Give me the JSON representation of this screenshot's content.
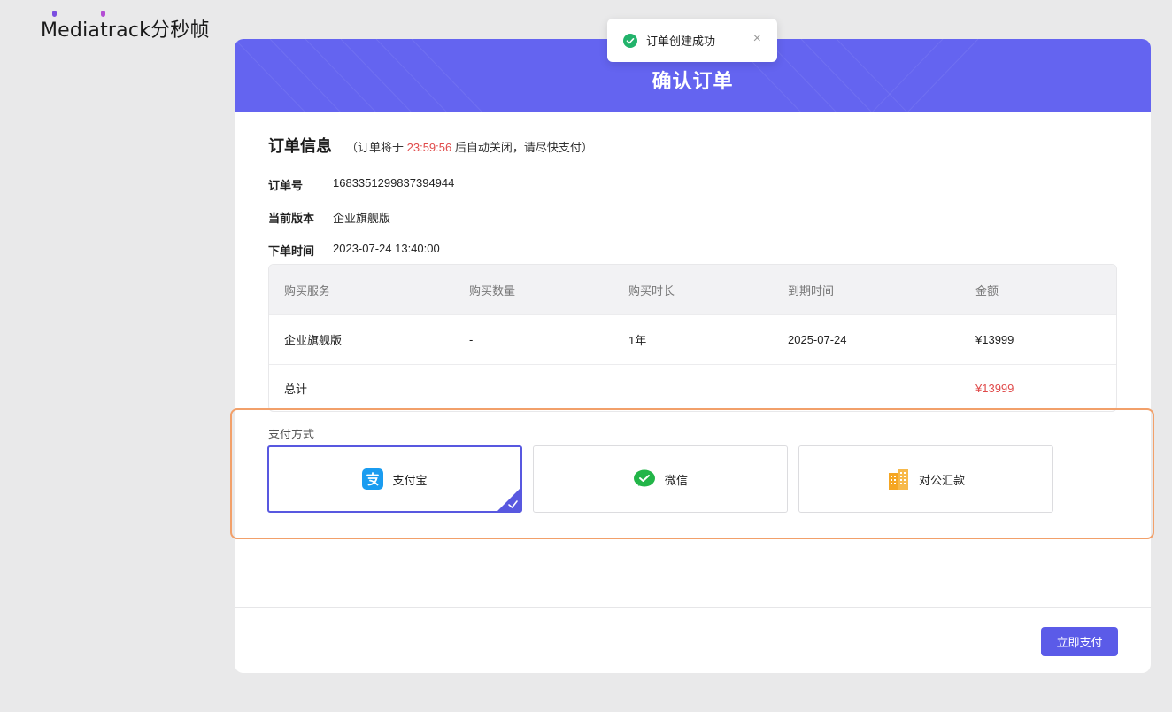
{
  "logo": {
    "text": "Mediatrack分秒帧"
  },
  "toast": {
    "text": "订单创建成功",
    "close": "×"
  },
  "header": {
    "title": "确认订单"
  },
  "order": {
    "section_title": "订单信息",
    "note_prefix": "（订单将于 ",
    "countdown": "23:59:56",
    "note_suffix": " 后自动关闭，请尽快支付）",
    "number_label": "订单号",
    "number": "1683351299837394944",
    "version_label": "当前版本",
    "version": "企业旗舰版",
    "time_label": "下单时间",
    "time": "2023-07-24 13:40:00"
  },
  "table": {
    "headers": [
      "购买服务",
      "购买数量",
      "购买时长",
      "到期时间",
      "金额"
    ],
    "rows": [
      [
        "企业旗舰版",
        "-",
        "1年",
        "2025-07-24",
        "¥13999"
      ]
    ],
    "total_label": "总计",
    "total_value": "¥13999"
  },
  "payment": {
    "label": "支付方式",
    "options": [
      {
        "name": "支付宝",
        "icon": "alipay-icon",
        "selected": true
      },
      {
        "name": "微信",
        "icon": "wechat-icon",
        "selected": false
      },
      {
        "name": "对公汇款",
        "icon": "bank-building-icon",
        "selected": false
      }
    ],
    "submit": "立即支付"
  },
  "colors": {
    "accent": "#5b5be8",
    "header": "#6464f0",
    "alert": "#e04a4a",
    "highlight": "#f2a06a",
    "success": "#22b36b"
  }
}
